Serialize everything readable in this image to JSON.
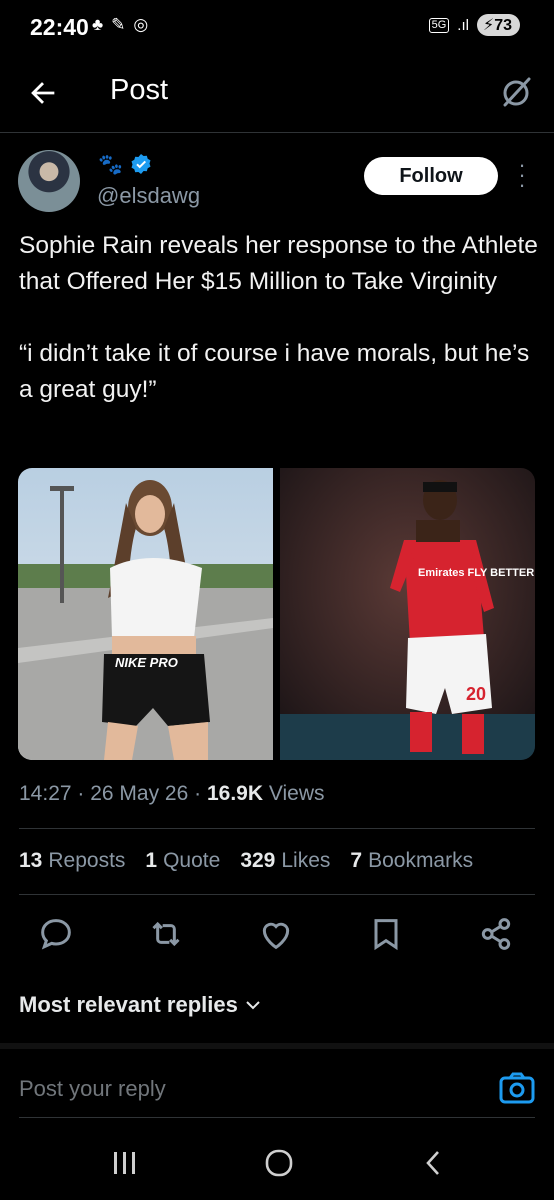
{
  "status_bar": {
    "time": "22:40",
    "network": "5G",
    "battery": "73"
  },
  "header": {
    "title": "Post"
  },
  "author": {
    "emoji": "🐾",
    "handle": "@elsdawg",
    "follow_label": "Follow"
  },
  "tweet": {
    "text": "Sophie Rain reveals her response to the Athlete that Offered Her $15 Million to Take Virginity\n\n“i didn’t take it of course i have morals, but he’s a great guy!”",
    "image2_caption": "Emirates FLY BETTER",
    "image2_number": "20",
    "image1_caption": "NIKE PRO"
  },
  "meta": {
    "time": "14:27",
    "date": "26 May 26",
    "views_count": "16.9K",
    "views_label": "Views"
  },
  "stats": {
    "reposts_count": "13",
    "reposts_label": "Reposts",
    "quote_count": "1",
    "quote_label": "Quote",
    "likes_count": "329",
    "likes_label": "Likes",
    "bookmarks_count": "7",
    "bookmarks_label": "Bookmarks"
  },
  "replies": {
    "sort_label": "Most relevant replies",
    "placeholder": "Post your reply"
  },
  "colors": {
    "background": "#000000",
    "text": "#e7e9ea",
    "muted": "#8b98a5",
    "accent": "#1d9bf0",
    "arsenal_red": "#d6232f"
  },
  "icons": [
    "back-arrow-icon",
    "grok-icon",
    "verified-icon",
    "more-icon",
    "reply-icon",
    "repost-icon",
    "like-icon",
    "bookmark-icon",
    "share-icon",
    "chevron-down-icon",
    "camera-icon",
    "recents-icon",
    "home-icon",
    "nav-back-icon"
  ]
}
